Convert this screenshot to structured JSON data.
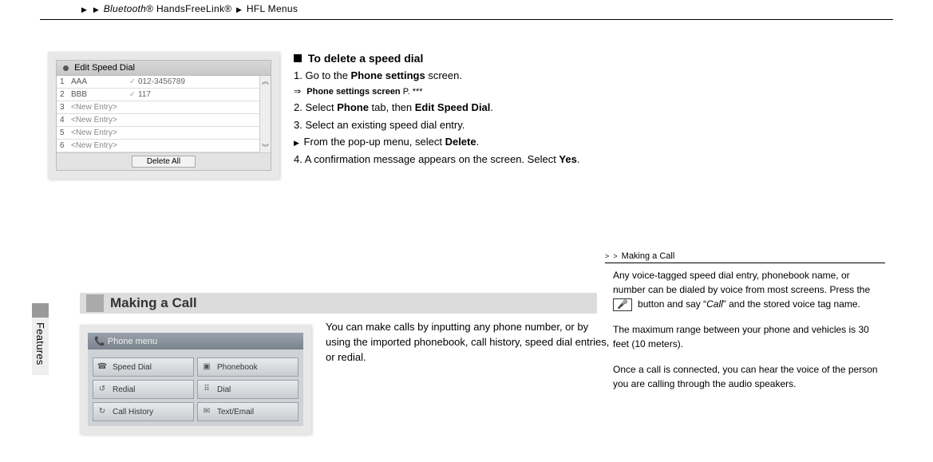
{
  "header": {
    "breadcrumb_bt": "Bluetooth",
    "breadcrumb_reg1": "®",
    "breadcrumb_hfl": "HandsFreeLink®",
    "breadcrumb_tail": "HFL Menus"
  },
  "sidetab": {
    "label": "Features"
  },
  "speed_dial_ui": {
    "title": "Edit Speed Dial",
    "rows": [
      {
        "idx": "1",
        "name": "AAA",
        "mic": "✓",
        "num": "012-3456789"
      },
      {
        "idx": "2",
        "name": "BBB",
        "mic": "✓",
        "num": "117"
      },
      {
        "idx": "3",
        "name": "<New Entry>",
        "mic": "",
        "num": ""
      },
      {
        "idx": "4",
        "name": "<New Entry>",
        "mic": "",
        "num": ""
      },
      {
        "idx": "5",
        "name": "<New Entry>",
        "mic": "",
        "num": ""
      },
      {
        "idx": "6",
        "name": "<New Entry>",
        "mic": "",
        "num": ""
      }
    ],
    "delete_all": "Delete All"
  },
  "instructions": {
    "heading": "To delete a speed dial",
    "step1_pre": "1.  Go to the ",
    "step1_bold": "Phone settings",
    "step1_post": " screen.",
    "step1_sub_pre": "Phone settings screen",
    "step1_sub_post": " P. ***",
    "step2_pre": "2.  Select ",
    "step2_b1": "Phone",
    "step2_mid": " tab, then ",
    "step2_b2": "Edit Speed Dial",
    "step2_post": ".",
    "step3": "3.  Select an existing speed dial entry.",
    "step3_sub_pre": "From the pop-up menu, select ",
    "step3_sub_bold": "Delete",
    "step3_sub_post": ".",
    "step4_pre": "4.  A confirmation message appears on the screen. Select ",
    "step4_bold": "Yes",
    "step4_post": "."
  },
  "section": {
    "title": "Making a Call"
  },
  "para": {
    "body": "You can make calls by inputting any phone number, or by using the imported phonebook, call history, speed dial entries, or redial."
  },
  "phone_menu": {
    "title": "Phone menu",
    "buttons": [
      {
        "icon": "speed-dial-icon",
        "glyph": "☎",
        "label": "Speed Dial"
      },
      {
        "icon": "phonebook-icon",
        "glyph": "▣",
        "label": "Phonebook"
      },
      {
        "icon": "redial-icon",
        "glyph": "↺",
        "label": "Redial"
      },
      {
        "icon": "dial-icon",
        "glyph": "⠿",
        "label": "Dial"
      },
      {
        "icon": "call-history-icon",
        "glyph": "↻",
        "label": "Call History"
      },
      {
        "icon": "text-email-icon",
        "glyph": "✉",
        "label": "Text/Email"
      }
    ]
  },
  "right": {
    "crumb": "Making a Call",
    "p1_a": "Any voice-tagged speed dial entry, phonebook name, or number can be dialed by voice from most screens. Press the ",
    "p1_icon": "🎤",
    "p1_b": " button and say “",
    "p1_call": "Call",
    "p1_c": "”  and the stored voice tag name.",
    "p2": "The maximum range between your phone and vehicles is 30 feet (10 meters).",
    "p3": "Once a call is connected, you can hear the voice of the person you are calling through the audio speakers."
  }
}
